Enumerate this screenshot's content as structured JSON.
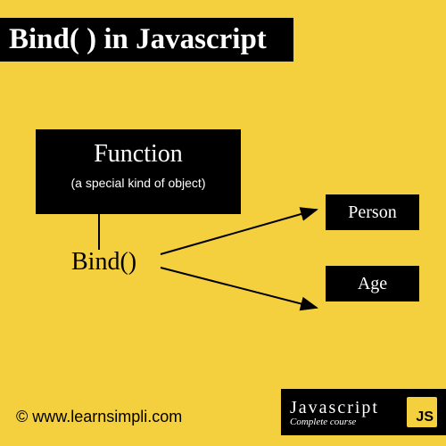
{
  "title": "Bind( ) in Javascript",
  "diagram": {
    "function_box": {
      "title": "Function",
      "subtitle": "(a special kind of object)"
    },
    "bind_label": "Bind()",
    "targets": {
      "person": "Person",
      "age": "Age"
    }
  },
  "credit": "© www.learnsimpli.com",
  "footer": {
    "title": "Javascript",
    "subtitle": "Complete course",
    "badge": "JS"
  }
}
